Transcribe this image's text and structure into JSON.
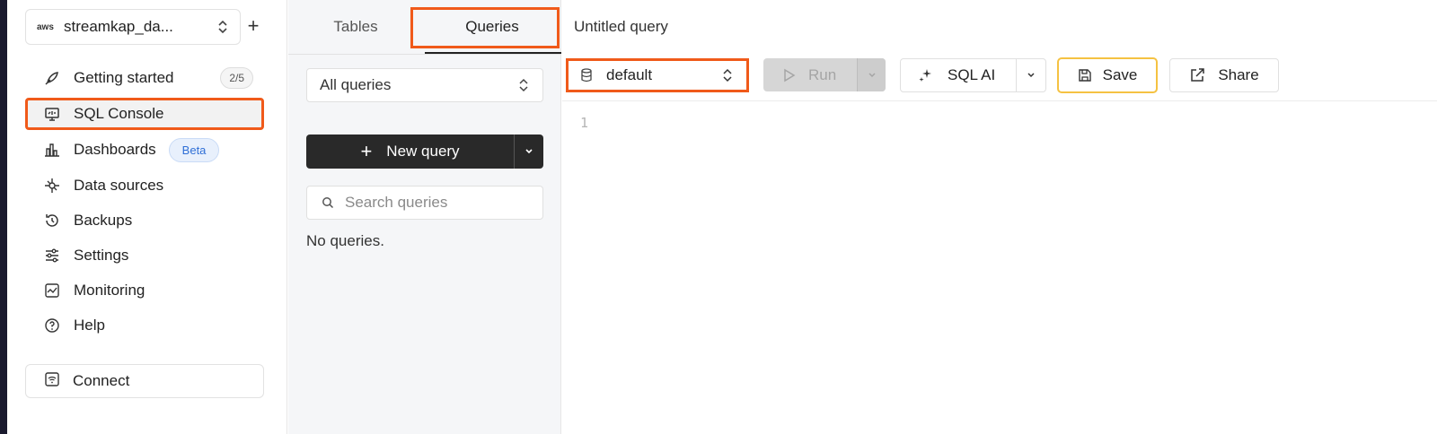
{
  "sidebar": {
    "service_provider": "aws",
    "service_name": "streamkap_da...",
    "add_label": "+",
    "nav": [
      {
        "id": "getting-started",
        "label": "Getting started",
        "icon": "rocket-icon",
        "badge": "2/5"
      },
      {
        "id": "sql-console",
        "label": "SQL Console",
        "icon": "console-icon",
        "active": true
      },
      {
        "id": "dashboards",
        "label": "Dashboards",
        "icon": "bar-chart-icon",
        "badge": "Beta"
      },
      {
        "id": "data-sources",
        "label": "Data sources",
        "icon": "data-sources-icon"
      },
      {
        "id": "backups",
        "label": "Backups",
        "icon": "history-icon"
      },
      {
        "id": "settings",
        "label": "Settings",
        "icon": "sliders-icon"
      },
      {
        "id": "monitoring",
        "label": "Monitoring",
        "icon": "chart-line-icon"
      },
      {
        "id": "help",
        "label": "Help",
        "icon": "help-circle-icon"
      }
    ],
    "connect_label": "Connect"
  },
  "queries_panel": {
    "tabs": [
      {
        "label": "Tables",
        "active": false
      },
      {
        "label": "Queries",
        "active": true
      }
    ],
    "filter": "All queries",
    "new_query_label": "New query",
    "new_query_icon": "+",
    "search_placeholder": "Search queries",
    "empty_text": "No queries."
  },
  "editor": {
    "title": "Untitled query",
    "database": "default",
    "run_label": "Run",
    "sql_ai_label": "SQL AI",
    "save_label": "Save",
    "share_label": "Share",
    "line_numbers": [
      "1"
    ]
  },
  "colors": {
    "highlight": "#f05a1a",
    "save_border": "#f5c242",
    "beta": "#2f6fd6"
  }
}
